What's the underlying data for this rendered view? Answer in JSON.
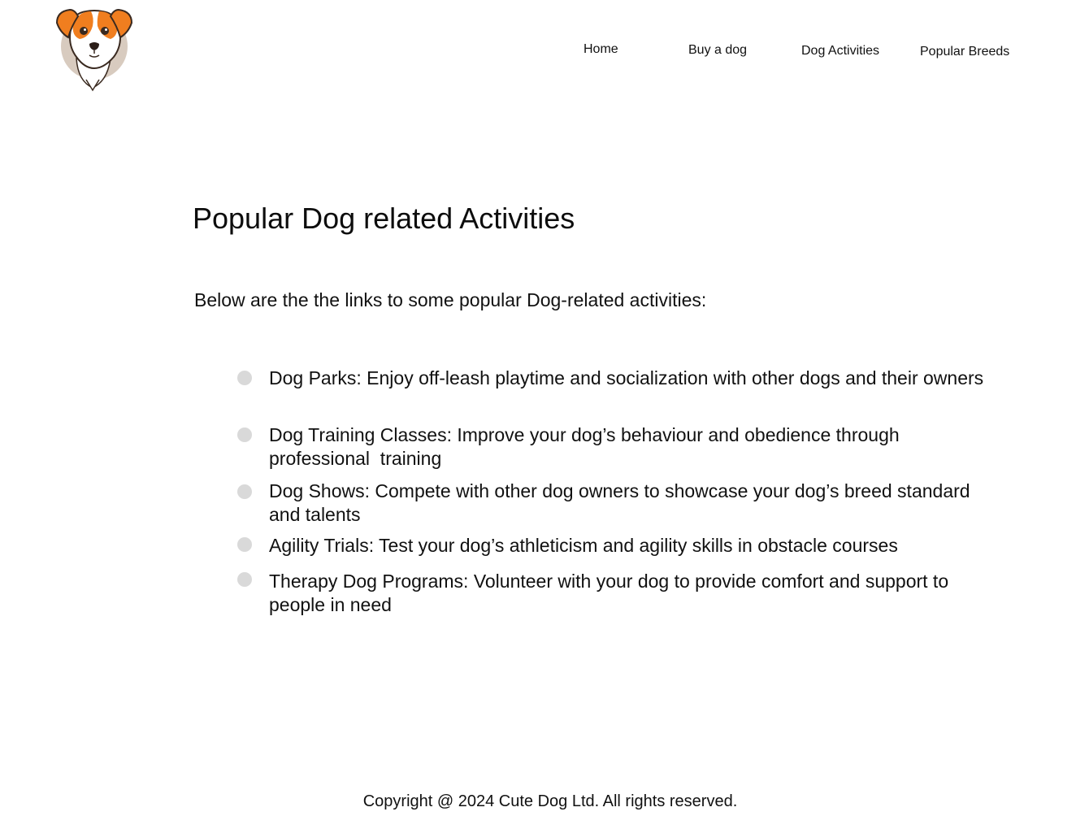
{
  "nav": {
    "home": "Home",
    "buy_a_dog": "Buy a dog",
    "dog_activities": "Dog Activities",
    "popular_breeds": "Popular Breeds"
  },
  "page": {
    "title": "Popular Dog related Activities",
    "intro": "Below are the the links to some popular Dog-related activities:"
  },
  "activities": [
    {
      "text": "Dog Parks: Enjoy off-leash playtime and socialization with other dogs and their owners"
    },
    {
      "text": "Dog Training Classes: Improve your dog’s behaviour and obedience through professional  training"
    },
    {
      "text": "Dog Shows: Compete with other dog owners to showcase your dog’s breed standard and talents"
    },
    {
      "text": "Agility Trials: Test your dog’s athleticism and agility skills in obstacle courses"
    },
    {
      "text": "Therapy Dog Programs: Volunteer with your dog to provide comfort and support to people in need"
    }
  ],
  "footer": {
    "copyright": "Copyright @ 2024 Cute Dog Ltd. All rights reserved."
  },
  "colors": {
    "bullet": "#d9d9d9",
    "logo_orange": "#f07e1f",
    "logo_backdrop": "#d8cbbf"
  },
  "icons": {
    "logo": "dog-head-logo-icon",
    "bullet": "circle-bullet-icon"
  }
}
